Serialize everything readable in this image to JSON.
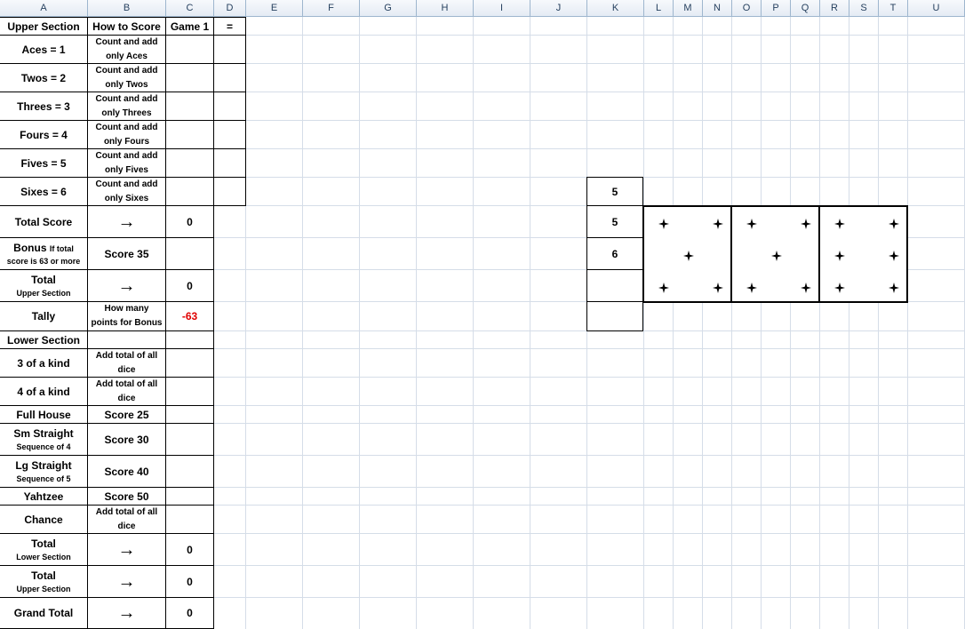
{
  "columns": [
    "A",
    "B",
    "C",
    "D",
    "E",
    "F",
    "G",
    "H",
    "I",
    "J",
    "K",
    "L",
    "M",
    "N",
    "O",
    "P",
    "Q",
    "R",
    "S",
    "T",
    "U"
  ],
  "header_row": {
    "a": "Upper Section",
    "b": "How to Score",
    "c": "Game 1",
    "d": "="
  },
  "upper_rows": [
    {
      "name": "Aces = 1",
      "how1": "Count and add",
      "how2": "only Aces"
    },
    {
      "name": "Twos = 2",
      "how1": "Count and add",
      "how2": "only Twos"
    },
    {
      "name": "Threes = 3",
      "how1": "Count and add",
      "how2": "only Threes"
    },
    {
      "name": "Fours = 4",
      "how1": "Count and add",
      "how2": "only Fours"
    },
    {
      "name": "Fives = 5",
      "how1": "Count and add",
      "how2": "only Fives"
    },
    {
      "name": "Sixes = 6",
      "how1": "Count and add",
      "how2": "only Sixes"
    }
  ],
  "total_score": {
    "label": "Total Score",
    "value": "0"
  },
  "bonus": {
    "label": "Bonus",
    "note1": "If total",
    "note2": "score is 63 or more",
    "how": "Score 35"
  },
  "total_upper": {
    "label": "Total",
    "sub": "Upper Section",
    "value": "0"
  },
  "tally": {
    "label": "Tally",
    "how1": "How many",
    "how2": "points for Bonus",
    "value": "-63"
  },
  "lower_header": "Lower Section",
  "three_kind": {
    "label": "3 of a kind",
    "how1": "Add total of all",
    "how2": "dice"
  },
  "four_kind": {
    "label": "4 of a kind",
    "how1": "Add total of all",
    "how2": "dice"
  },
  "full_house": {
    "label": "Full House",
    "how": "Score 25"
  },
  "sm_straight": {
    "label": "Sm Straight",
    "sub": "Sequence of 4",
    "how": "Score 30"
  },
  "lg_straight": {
    "label": "Lg Straight",
    "sub": "Sequence of 5",
    "how": "Score 40"
  },
  "yahtzee": {
    "label": "Yahtzee",
    "how": "Score 50"
  },
  "chance": {
    "label": "Chance",
    "how1": "Add total of all",
    "how2": "dice"
  },
  "total_lower": {
    "label": "Total",
    "sub": "Lower Section",
    "value": "0"
  },
  "total_upper_2": {
    "label": "Total",
    "sub": "Upper Section",
    "value": "0"
  },
  "grand_total": {
    "label": "Grand Total",
    "value": "0"
  },
  "arrow_glyph": "→",
  "dice_values": [
    "5",
    "5",
    "6"
  ],
  "dice": [
    5,
    5,
    6
  ],
  "pip_icon": "four-point-star-icon"
}
